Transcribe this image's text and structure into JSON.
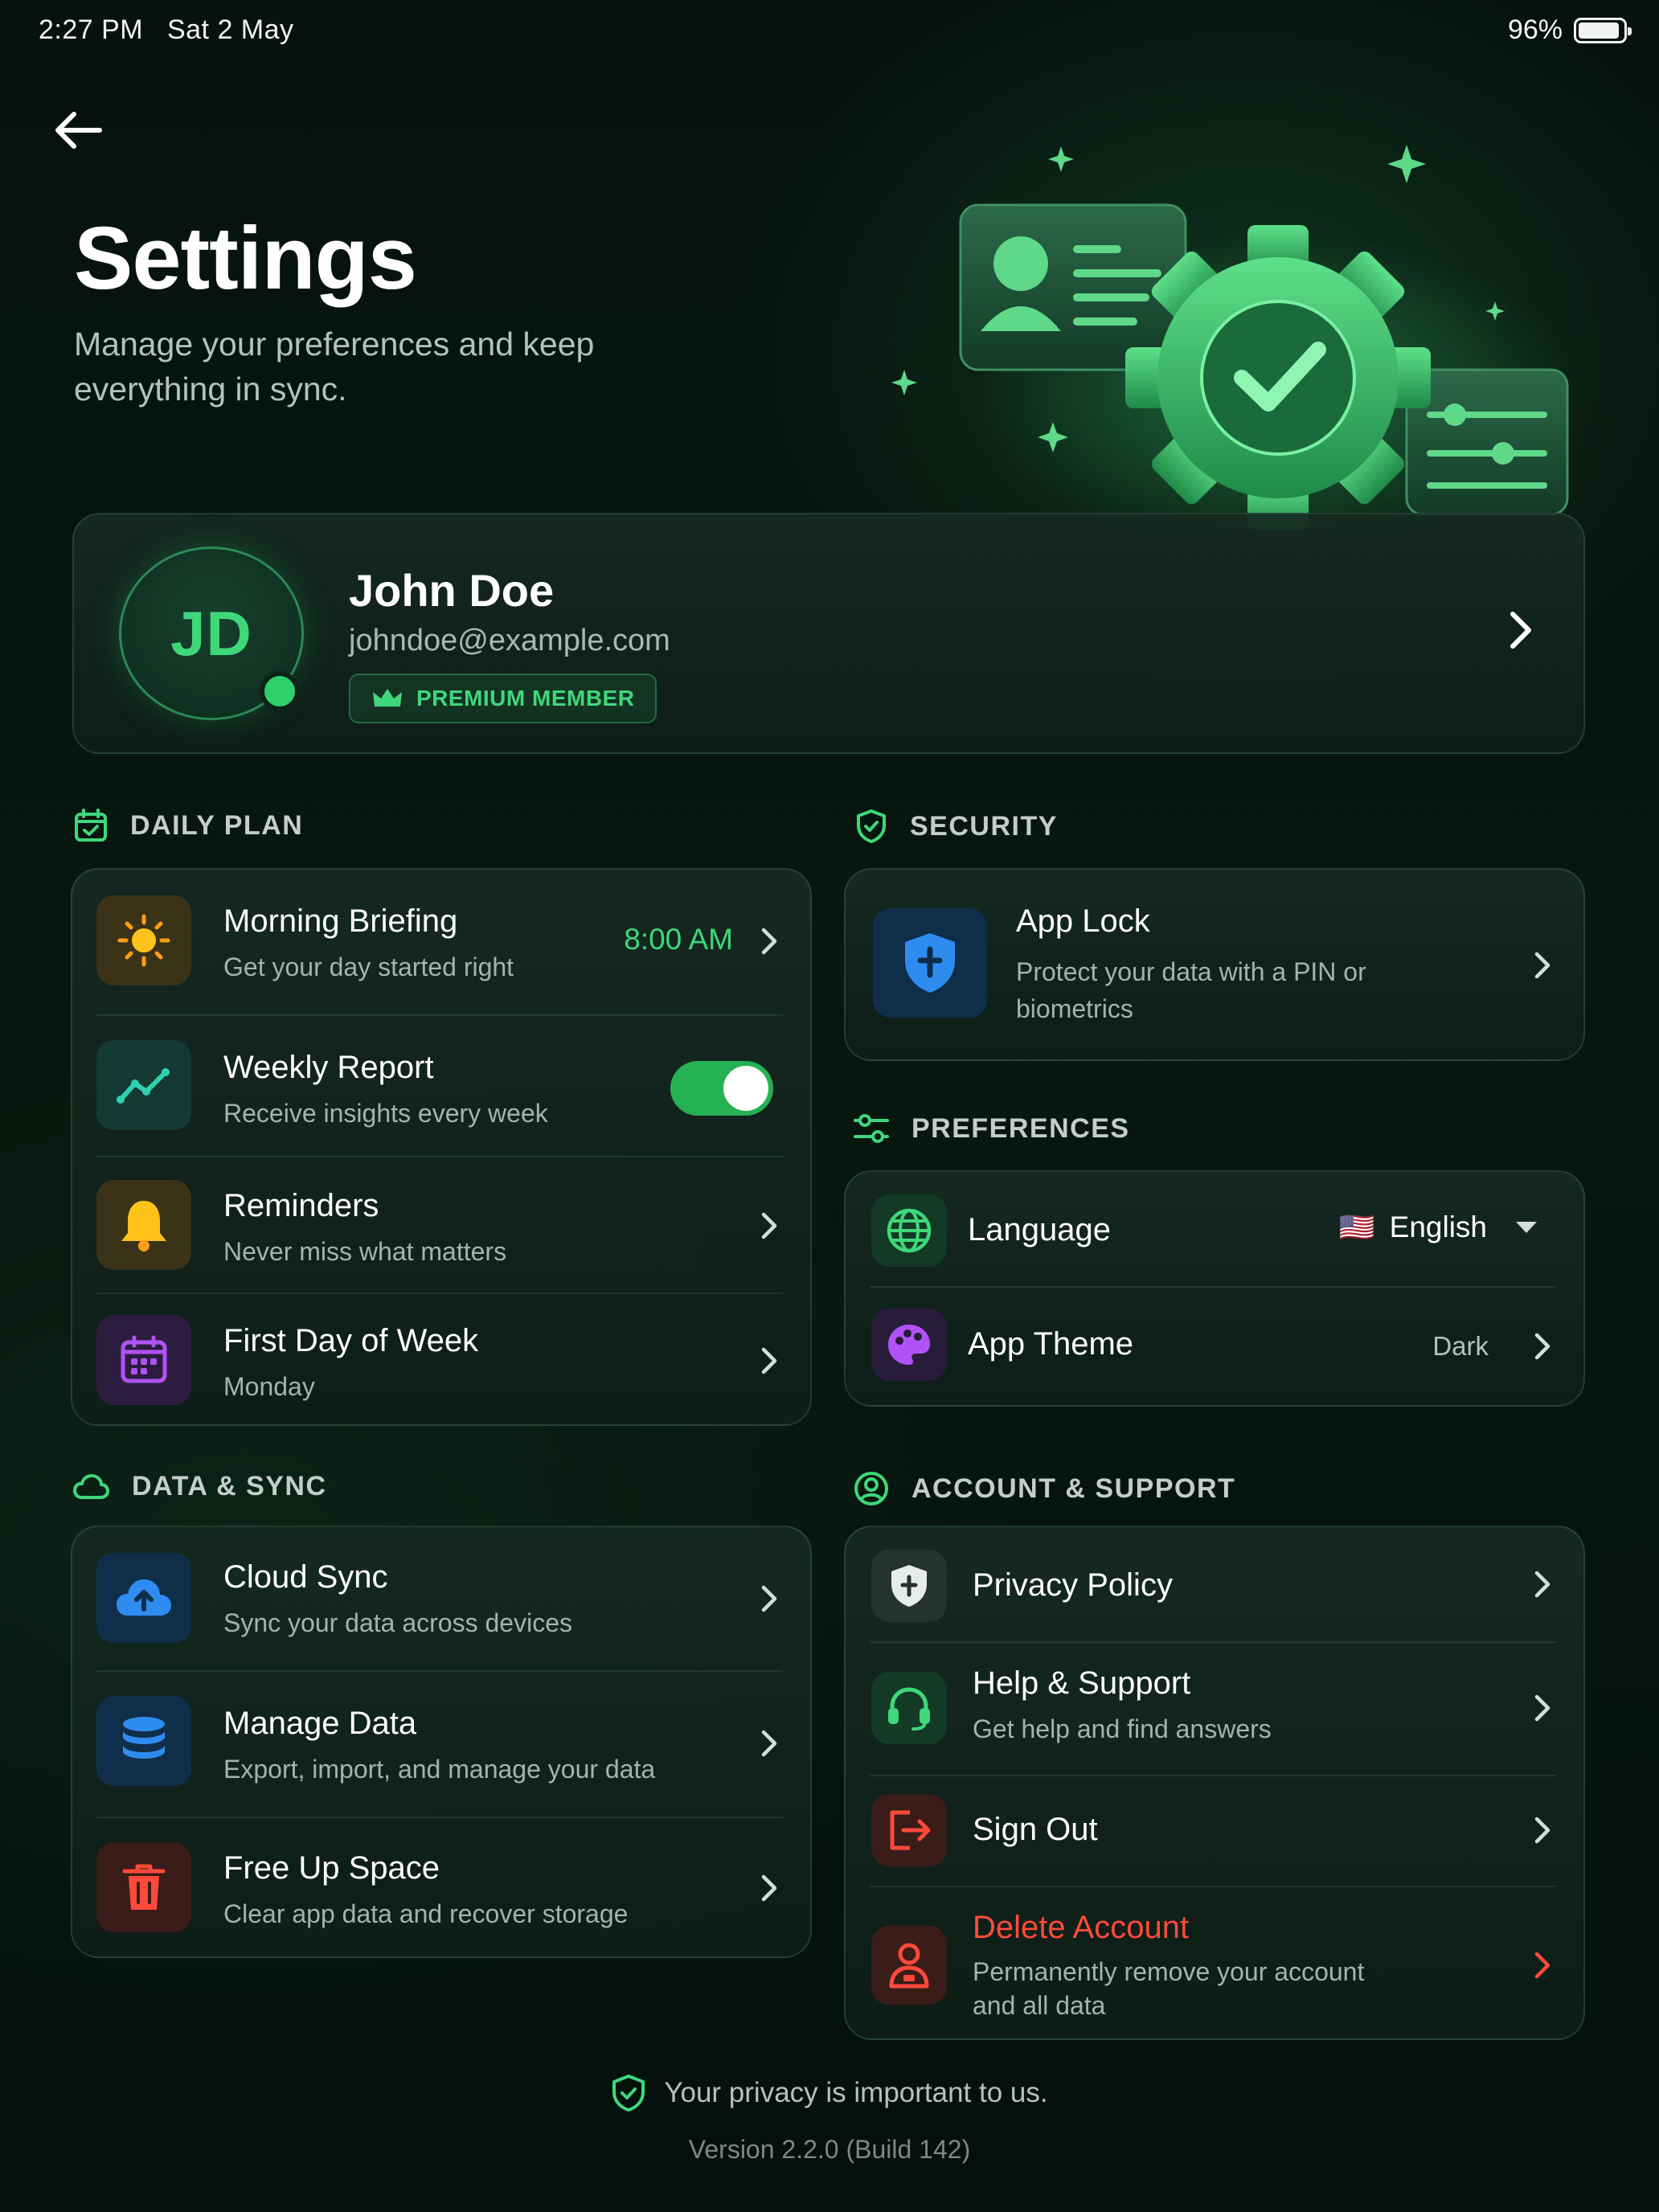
{
  "status_bar": {
    "time": "2:27 PM",
    "date": "Sat 2 May",
    "battery": "96%",
    "battery_level": 0.96
  },
  "header": {
    "title": "Settings",
    "subtitle": "Manage your preferences and keep everything in sync.",
    "back_icon": "arrow-left-icon"
  },
  "profile": {
    "initials": "JD",
    "name": "John Doe",
    "email": "johndoe@example.com",
    "badge": "PREMIUM MEMBER",
    "online": true
  },
  "sections": {
    "daily_plan": {
      "label": "DAILY PLAN",
      "items": [
        {
          "title": "Morning Briefing",
          "subtitle": "Get your day started right",
          "value": "8:00 AM",
          "icon": "sun-icon"
        },
        {
          "title": "Weekly Report",
          "subtitle": "Receive insights every week",
          "toggle": true,
          "icon": "trend-icon"
        },
        {
          "title": "Reminders",
          "subtitle": "Never miss what matters",
          "icon": "bell-icon"
        },
        {
          "title": "First Day of Week",
          "subtitle": "Monday",
          "icon": "calendar-icon"
        }
      ]
    },
    "security": {
      "label": "SECURITY",
      "items": [
        {
          "title": "App Lock",
          "subtitle": "Protect your data with a PIN or biometrics",
          "icon": "shield-icon"
        }
      ]
    },
    "preferences": {
      "label": "PREFERENCES",
      "items": [
        {
          "title": "Language",
          "value": "English",
          "flag": "🇺🇸",
          "icon": "globe-icon"
        },
        {
          "title": "App Theme",
          "value": "Dark",
          "icon": "palette-icon"
        }
      ]
    },
    "data_sync": {
      "label": "DATA & SYNC",
      "items": [
        {
          "title": "Cloud Sync",
          "subtitle": "Sync your data across devices",
          "icon": "cloud-upload-icon"
        },
        {
          "title": "Manage Data",
          "subtitle": "Export, import, and manage your data",
          "icon": "database-icon"
        },
        {
          "title": "Free Up Space",
          "subtitle": "Clear app data and recover storage",
          "icon": "trash-icon"
        }
      ]
    },
    "account_support": {
      "label": "ACCOUNT & SUPPORT",
      "items": [
        {
          "title": "Privacy Policy",
          "icon": "privacy-shield-icon"
        },
        {
          "title": "Help & Support",
          "subtitle": "Get help and find answers",
          "icon": "headset-icon"
        },
        {
          "title": "Sign Out",
          "icon": "sign-out-icon"
        },
        {
          "title": "Delete Account",
          "subtitle": "Permanently remove your account and all data",
          "icon": "delete-user-icon"
        }
      ]
    }
  },
  "footer": {
    "privacy": "Your privacy is important to us.",
    "version": "Version 2.2.0 (Build 142)"
  },
  "colors": {
    "accent": "#3fd77a",
    "background": "#061410",
    "danger": "#ff4a3a",
    "toggle_on": "#26b152"
  }
}
